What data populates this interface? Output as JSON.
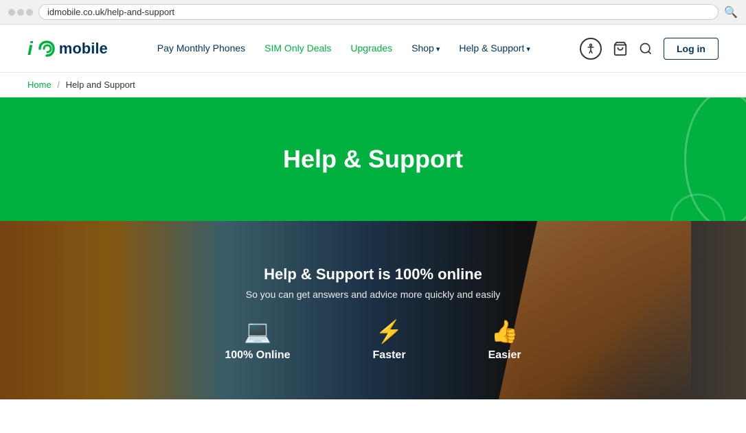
{
  "browser": {
    "url": "idmobile.co.uk/help-and-support"
  },
  "header": {
    "logo_i": "i",
    "logo_text": "mobile",
    "nav": {
      "pay_monthly": "Pay Monthly Phones",
      "sim_only": "SIM Only Deals",
      "upgrades": "Upgrades",
      "shop": "Shop",
      "help_support": "Help & Support",
      "login": "Log in"
    }
  },
  "breadcrumb": {
    "home": "Home",
    "separator": "/",
    "current": "Help and Support"
  },
  "hero": {
    "title": "Help & Support"
  },
  "photo_section": {
    "headline": "Help & Support is 100% online",
    "subtext": "So you can get answers and advice more quickly and easily",
    "features": [
      {
        "icon": "💻",
        "label": "100% Online"
      },
      {
        "icon": "⚡",
        "label": "Faster"
      },
      {
        "icon": "👍",
        "label": "Easier"
      }
    ]
  }
}
